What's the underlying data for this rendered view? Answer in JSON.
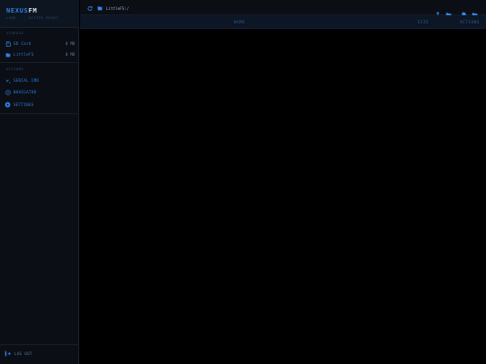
{
  "brand": {
    "name": "NEXUS",
    "suffix": "FM",
    "subtitle": "LINK ... ACTIVE READY"
  },
  "sidebar": {
    "storage_label": "STORAGE",
    "storage": [
      {
        "label": "SD Card",
        "value": "0 MB",
        "icon": "sd-card-icon"
      },
      {
        "label": "LittleFS",
        "value": "0 MB",
        "icon": "folder-icon"
      }
    ],
    "actions_label": "ACTIONS",
    "actions": [
      {
        "label": "SERIAL CMD",
        "icon": "terminal-icon"
      },
      {
        "label": "NAVIGATOR",
        "icon": "compass-icon"
      },
      {
        "label": "SETTINGS",
        "icon": "gear-icon"
      }
    ],
    "logout": "LOG OUT"
  },
  "topbar": {
    "path": "LittleFS:/",
    "icons": [
      "upload-icon",
      "new-folder-icon",
      "new-file-icon",
      "folder-open-icon"
    ]
  },
  "table": {
    "headers": [
      "NAME",
      "SIZE",
      "ACTIONS"
    ],
    "rows": []
  },
  "colors": {
    "accent": "#2f7fe0",
    "background": "#000000",
    "sidebar": "#0b0f15",
    "muted": "#27527e"
  }
}
